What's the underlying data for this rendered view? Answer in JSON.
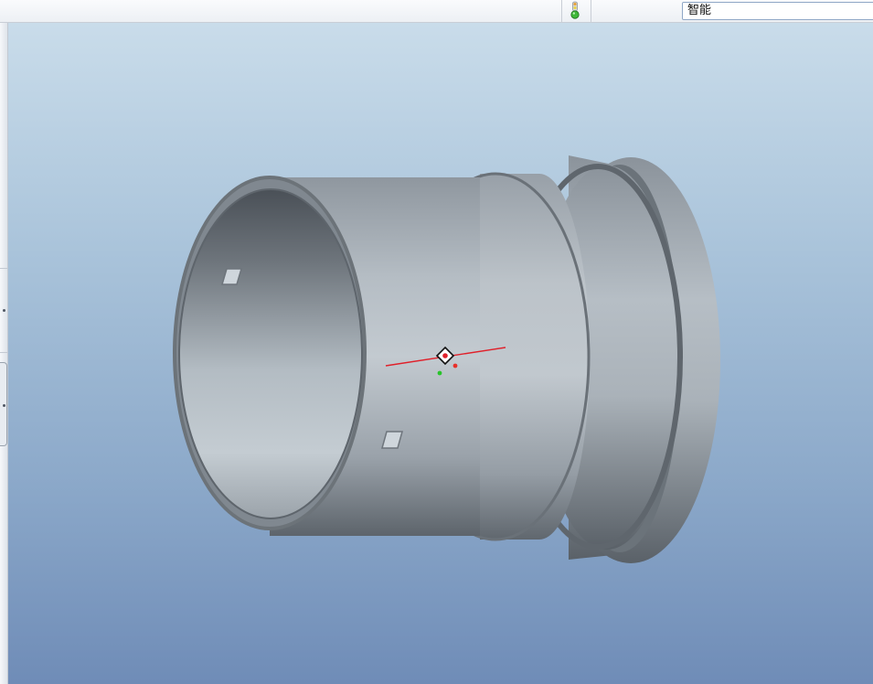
{
  "toolbar": {
    "filter_value": "智能"
  },
  "status_light": {
    "icon": "traffic-light-icon",
    "colors": {
      "red": "#e6a03a",
      "yellow": "#e9d34a",
      "green": "#3fb83a"
    }
  },
  "viewport": {
    "icon": "spin-center-icon",
    "background_top": "#c9dcea",
    "background_bottom": "#6f8cb7",
    "part_color": "#a7b0b8"
  }
}
